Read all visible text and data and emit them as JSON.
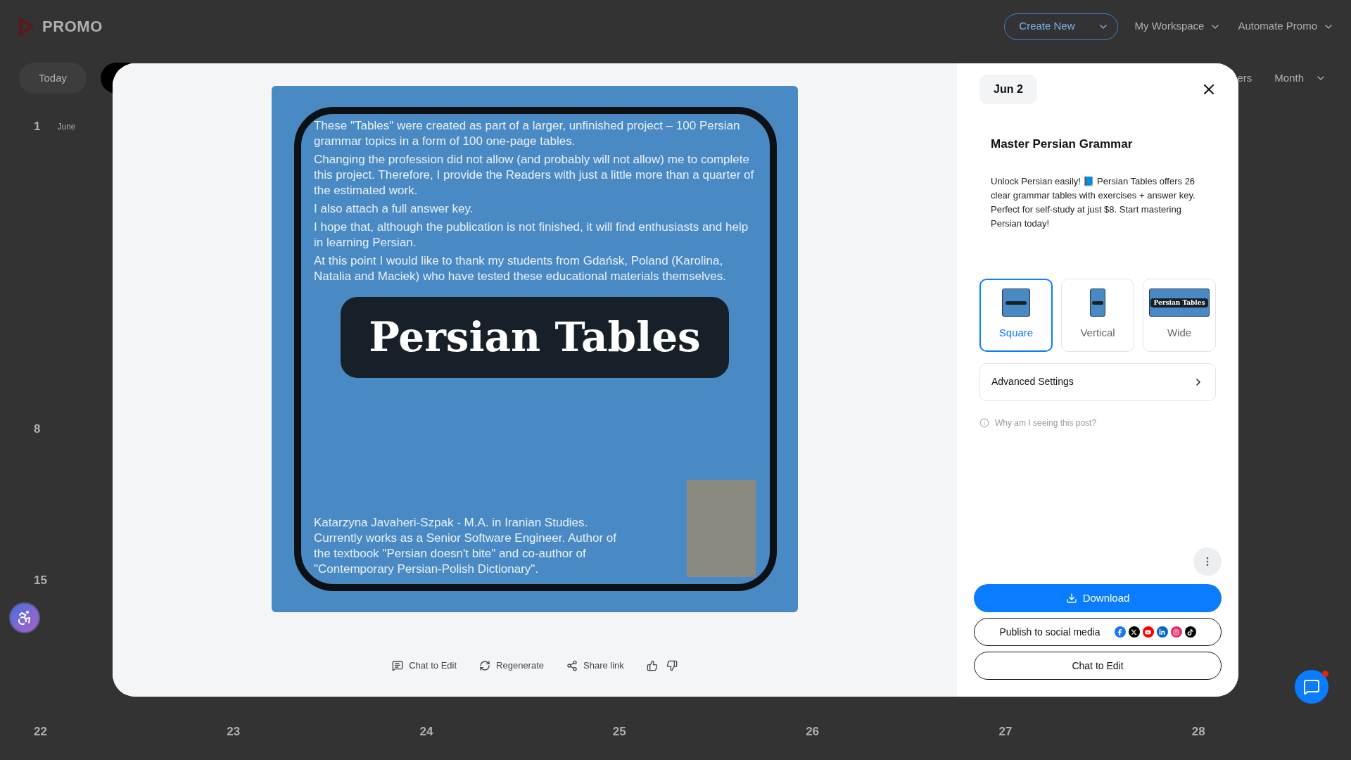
{
  "header": {
    "logo": "PROMO",
    "create_button": "Create New",
    "menus": [
      "My Workspace",
      "Automate Promo"
    ]
  },
  "toolbar": {
    "today": "Today",
    "filters": "ers",
    "view": "Month"
  },
  "calendar": {
    "month_label": "June",
    "weeks": [
      [
        "1"
      ],
      [
        "8"
      ],
      [
        "15"
      ],
      [
        "22",
        "23",
        "24",
        "25",
        "26",
        "27",
        "28"
      ]
    ]
  },
  "modal": {
    "date": "Jun 2",
    "title": "Master Persian Grammar",
    "description": "Unlock Persian easily! 📘 Persian Tables offers 26 clear grammar tables with exercises + answer key. Perfect for self-study at just $8. Start mastering Persian today!",
    "post": {
      "paragraphs": [
        "These \"Tables\" were created as part of a larger, unfinished project – 100 Persian grammar topics in a form of 100 one-page tables.",
        "Changing the profession did not allow (and probably will not allow) me to complete this project. Therefore, I provide the Readers with just a little more than a quarter of the estimated work.",
        "I also attach a full answer key.",
        "I hope that, although the publication is not finished, it will find enthusiasts and help in learning Persian.",
        "At this point I would like to thank my students from Gdańsk, Poland (Karolina, Natalia and Maciek) who have tested these educational materials themselves."
      ],
      "heading": "Persian Tables",
      "author": "Katarzyna Javaheri-Szpak - M.A. in Iranian Studies. Currently works as a Senior Software Engineer. Author of the textbook \"Persian doesn't bite\" and co-author of \"Contemporary Persian-Polish Dictionary\"."
    },
    "actions": [
      {
        "kind": "chat",
        "label": "Chat to Edit"
      },
      {
        "kind": "regenerate",
        "label": "Regenerate"
      },
      {
        "kind": "share",
        "label": "Share link"
      }
    ],
    "formats": [
      {
        "kind": "square",
        "label": "Square",
        "selected": true
      },
      {
        "kind": "vertical",
        "label": "Vertical",
        "selected": false
      },
      {
        "kind": "wide",
        "label": "Wide",
        "selected": false,
        "thumb_text": "Persian Tables"
      }
    ],
    "advanced": "Advanced Settings",
    "why": "Why am I seeing this post?",
    "download": "Download",
    "publish": "Publish to social media",
    "chat_edit": "Chat to Edit"
  }
}
